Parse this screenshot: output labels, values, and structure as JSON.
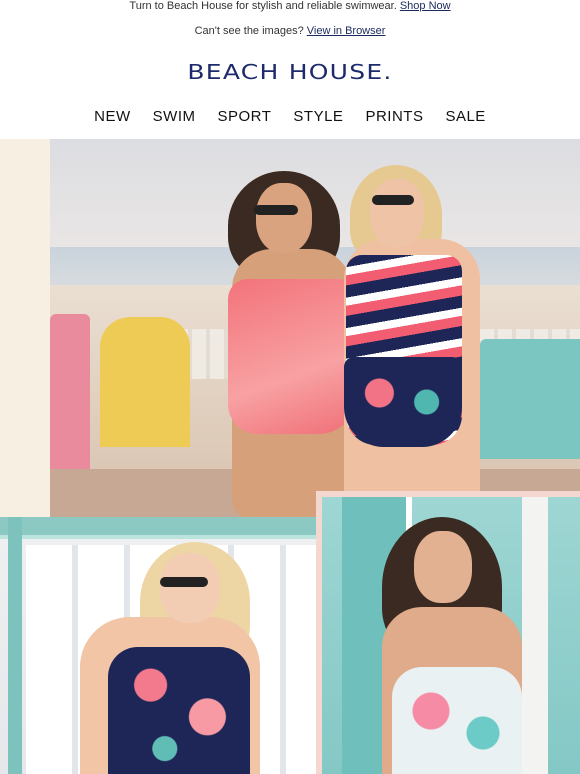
{
  "header": {
    "promo_text": "Turn to Beach House for stylish and reliable swimwear.",
    "promo_link": "Shop Now",
    "view_text": "Can't see the images?",
    "view_link": "View in Browser"
  },
  "brand": {
    "logo_text": "BEACH HOUSE.",
    "color": "#1d2a6b"
  },
  "nav": {
    "items": [
      "NEW",
      "SWIM",
      "SPORT",
      "STYLE",
      "PRINTS",
      "SALE"
    ]
  },
  "images": {
    "hero": "two-women-in-swimwear-on-beach",
    "left": "woman-in-floral-tankini-by-beach-house",
    "right": "woman-in-floral-swimsuit-back-view"
  }
}
